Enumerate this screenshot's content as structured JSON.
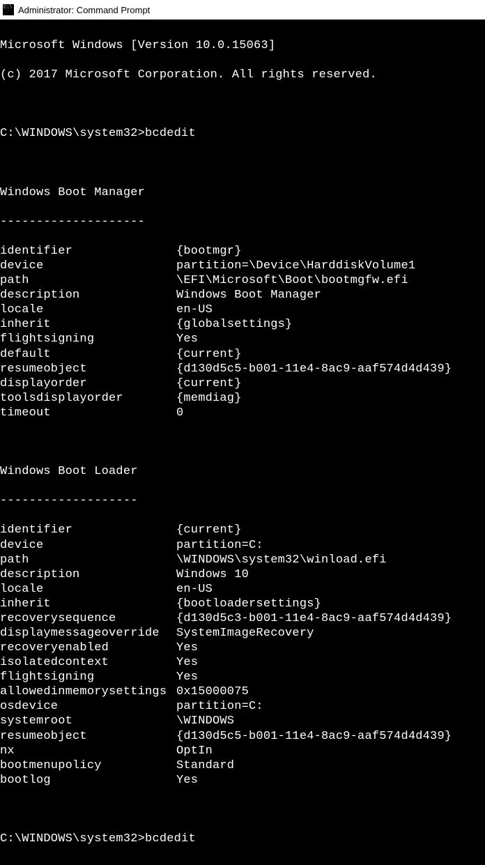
{
  "titlebar": {
    "title": "Administrator: Command Prompt"
  },
  "header": {
    "line1": "Microsoft Windows [Version 10.0.15063]",
    "line2": "(c) 2017 Microsoft Corporation. All rights reserved."
  },
  "prompt1": {
    "path": "C:\\WINDOWS\\system32>",
    "cmd": "bcdedit"
  },
  "section1": {
    "title": "Windows Boot Manager",
    "divider": "--------------------",
    "rows": [
      {
        "k": "identifier",
        "v": "{bootmgr}"
      },
      {
        "k": "device",
        "v": "partition=\\Device\\HarddiskVolume1"
      },
      {
        "k": "path",
        "v": "\\EFI\\Microsoft\\Boot\\bootmgfw.efi"
      },
      {
        "k": "description",
        "v": "Windows Boot Manager"
      },
      {
        "k": "locale",
        "v": "en-US"
      },
      {
        "k": "inherit",
        "v": "{globalsettings}"
      },
      {
        "k": "flightsigning",
        "v": "Yes"
      },
      {
        "k": "default",
        "v": "{current}"
      },
      {
        "k": "resumeobject",
        "v": "{d130d5c5-b001-11e4-8ac9-aaf574d4d439}"
      },
      {
        "k": "displayorder",
        "v": "{current}"
      },
      {
        "k": "toolsdisplayorder",
        "v": "{memdiag}"
      },
      {
        "k": "timeout",
        "v": "0"
      }
    ]
  },
  "section2": {
    "title": "Windows Boot Loader",
    "divider": "-------------------",
    "rows": [
      {
        "k": "identifier",
        "v": "{current}"
      },
      {
        "k": "device",
        "v": "partition=C:"
      },
      {
        "k": "path",
        "v": "\\WINDOWS\\system32\\winload.efi"
      },
      {
        "k": "description",
        "v": "Windows 10"
      },
      {
        "k": "locale",
        "v": "en-US"
      },
      {
        "k": "inherit",
        "v": "{bootloadersettings}"
      },
      {
        "k": "recoverysequence",
        "v": "{d130d5c3-b001-11e4-8ac9-aaf574d4d439}"
      },
      {
        "k": "displaymessageoverride",
        "v": "SystemImageRecovery"
      },
      {
        "k": "recoveryenabled",
        "v": "Yes"
      },
      {
        "k": "isolatedcontext",
        "v": "Yes"
      },
      {
        "k": "flightsigning",
        "v": "Yes"
      },
      {
        "k": "allowedinmemorysettings",
        "v": "0x15000075"
      },
      {
        "k": "osdevice",
        "v": "partition=C:"
      },
      {
        "k": "systemroot",
        "v": "\\WINDOWS"
      },
      {
        "k": "resumeobject",
        "v": "{d130d5c5-b001-11e4-8ac9-aaf574d4d439}"
      },
      {
        "k": "nx",
        "v": "OptIn"
      },
      {
        "k": "bootmenupolicy",
        "v": "Standard"
      },
      {
        "k": "bootlog",
        "v": "Yes"
      }
    ]
  },
  "prompt2": {
    "path": "C:\\WINDOWS\\system32>",
    "cmd": "bcdedit"
  }
}
